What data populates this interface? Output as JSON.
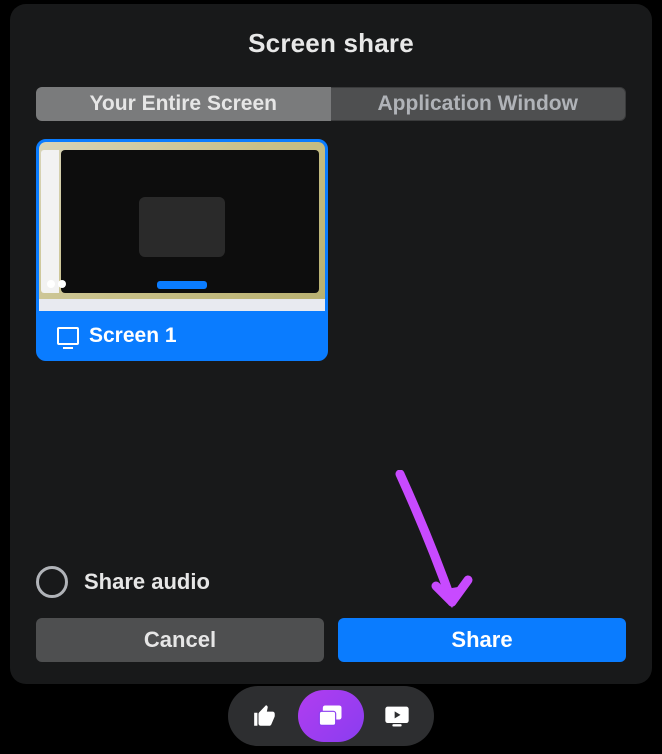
{
  "title": "Screen share",
  "tabs": {
    "entire": "Your Entire Screen",
    "appwin": "Application Window"
  },
  "screens": [
    {
      "label": "Screen 1",
      "selected": true
    }
  ],
  "shareAudio": {
    "label": "Share audio",
    "checked": false
  },
  "actions": {
    "cancel": "Cancel",
    "share": "Share"
  },
  "annotation": {
    "arrow_color": "#c84aff"
  },
  "toolbar": {
    "items": [
      {
        "name": "thumbs-up-icon",
        "active": false
      },
      {
        "name": "cast-icon",
        "active": true
      },
      {
        "name": "watch-together-icon",
        "active": false
      }
    ]
  },
  "colors": {
    "accent": "#0A7CFF"
  }
}
